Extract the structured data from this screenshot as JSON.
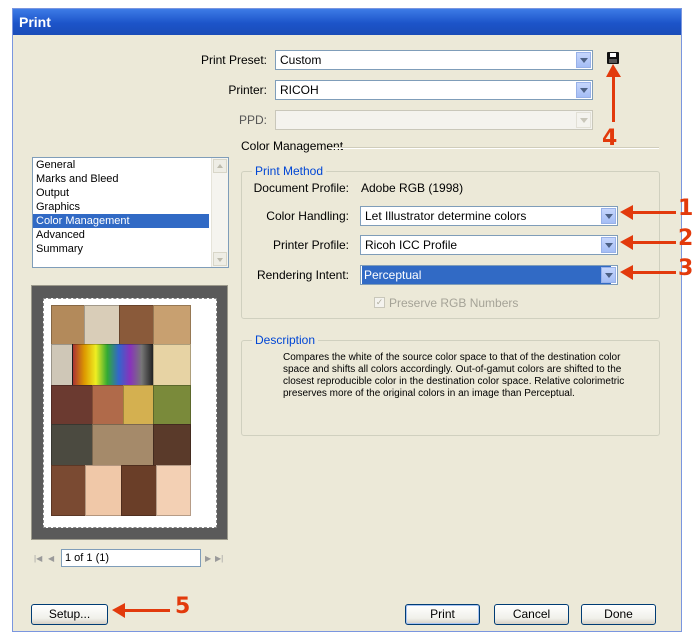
{
  "window": {
    "title": "Print"
  },
  "print_preset": {
    "label": "Print Preset:",
    "value": "Custom"
  },
  "printer": {
    "label": "Printer:",
    "value": "RICOH"
  },
  "ppd": {
    "label": "PPD:",
    "value": ""
  },
  "section_title": "Color Management",
  "categories": {
    "items": [
      "General",
      "Marks and Bleed",
      "Output",
      "Graphics",
      "Color Management",
      "Advanced",
      "Summary"
    ],
    "selected": "Color Management"
  },
  "print_method": {
    "title": "Print Method",
    "document_profile_label": "Document Profile:",
    "document_profile_value": "Adobe RGB (1998)",
    "color_handling_label": "Color Handling:",
    "color_handling_value": "Let Illustrator determine colors",
    "printer_profile_label": "Printer Profile:",
    "printer_profile_value": "Ricoh ICC Profile",
    "rendering_intent_label": "Rendering Intent:",
    "rendering_intent_value": "Perceptual",
    "preserve_rgb_label": "Preserve RGB Numbers",
    "preserve_rgb_checked": true
  },
  "description": {
    "title": "Description",
    "lines": [
      "Compares the white of the source color space to that of the destination color",
      "space and shifts all colors accordingly. Out-of-gamut colors are shifted to the",
      "closest reproducible color in the destination color space. Relative colorimetric",
      "preserves more of the original colors in an image than Perceptual."
    ]
  },
  "preview_nav": {
    "page_value": "1 of 1 (1)"
  },
  "buttons": {
    "setup": "Setup...",
    "print": "Print",
    "cancel": "Cancel",
    "done": "Done"
  },
  "annotations": [
    "1",
    "2",
    "3",
    "4",
    "5"
  ],
  "colors": {
    "accent": "#316ac5",
    "title_blue": "#0046d5",
    "annotation_red": "#e23a0c"
  }
}
